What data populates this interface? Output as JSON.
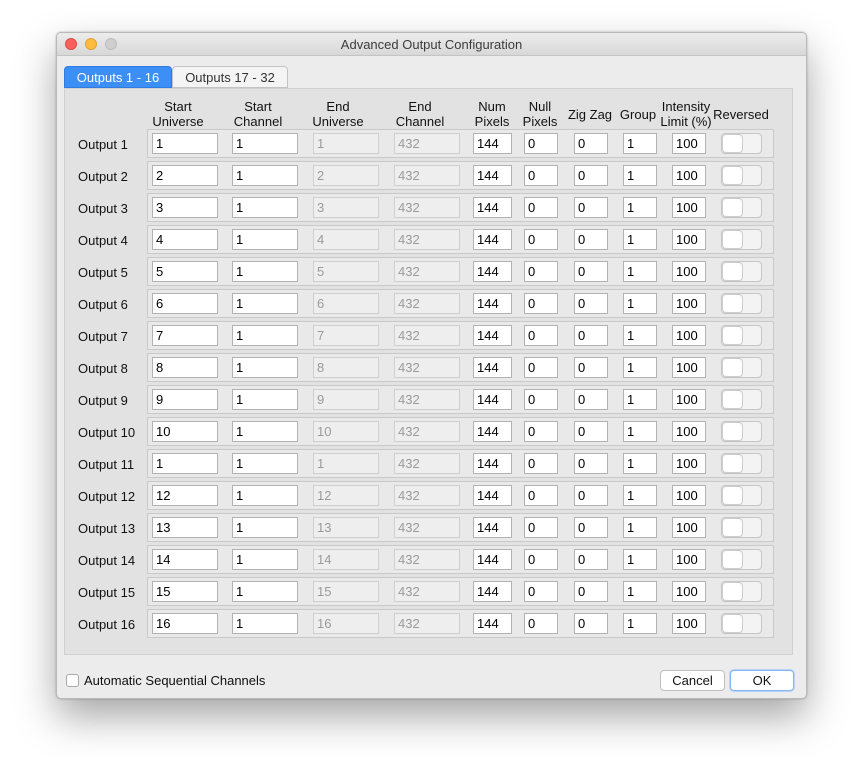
{
  "window": {
    "title": "Advanced Output Configuration"
  },
  "tabs": [
    {
      "label": "Outputs 1 - 16",
      "active": true
    },
    {
      "label": "Outputs 17 - 32",
      "active": false
    }
  ],
  "columns": {
    "start_universe": [
      "Start",
      "Universe"
    ],
    "start_channel": [
      "Start",
      "Channel"
    ],
    "end_universe": [
      "End",
      "Universe"
    ],
    "end_channel": [
      "End",
      "Channel"
    ],
    "num_pixels": [
      "Num",
      "Pixels"
    ],
    "null_pixels": [
      "Null",
      "Pixels"
    ],
    "zig_zag": [
      "Zig Zag"
    ],
    "group": [
      "Group"
    ],
    "intensity": [
      "Intensity",
      "Limit (%)"
    ],
    "reversed": [
      "Reversed"
    ]
  },
  "rows": [
    {
      "label": "Output 1",
      "start_universe": "1",
      "start_channel": "1",
      "end_universe": "1",
      "end_channel": "432",
      "num_pixels": "144",
      "null_pixels": "0",
      "zig_zag": "0",
      "group": "1",
      "intensity": "100",
      "reversed": false
    },
    {
      "label": "Output 2",
      "start_universe": "2",
      "start_channel": "1",
      "end_universe": "2",
      "end_channel": "432",
      "num_pixels": "144",
      "null_pixels": "0",
      "zig_zag": "0",
      "group": "1",
      "intensity": "100",
      "reversed": false
    },
    {
      "label": "Output 3",
      "start_universe": "3",
      "start_channel": "1",
      "end_universe": "3",
      "end_channel": "432",
      "num_pixels": "144",
      "null_pixels": "0",
      "zig_zag": "0",
      "group": "1",
      "intensity": "100",
      "reversed": false
    },
    {
      "label": "Output 4",
      "start_universe": "4",
      "start_channel": "1",
      "end_universe": "4",
      "end_channel": "432",
      "num_pixels": "144",
      "null_pixels": "0",
      "zig_zag": "0",
      "group": "1",
      "intensity": "100",
      "reversed": false
    },
    {
      "label": "Output 5",
      "start_universe": "5",
      "start_channel": "1",
      "end_universe": "5",
      "end_channel": "432",
      "num_pixels": "144",
      "null_pixels": "0",
      "zig_zag": "0",
      "group": "1",
      "intensity": "100",
      "reversed": false
    },
    {
      "label": "Output 6",
      "start_universe": "6",
      "start_channel": "1",
      "end_universe": "6",
      "end_channel": "432",
      "num_pixels": "144",
      "null_pixels": "0",
      "zig_zag": "0",
      "group": "1",
      "intensity": "100",
      "reversed": false
    },
    {
      "label": "Output 7",
      "start_universe": "7",
      "start_channel": "1",
      "end_universe": "7",
      "end_channel": "432",
      "num_pixels": "144",
      "null_pixels": "0",
      "zig_zag": "0",
      "group": "1",
      "intensity": "100",
      "reversed": false
    },
    {
      "label": "Output 8",
      "start_universe": "8",
      "start_channel": "1",
      "end_universe": "8",
      "end_channel": "432",
      "num_pixels": "144",
      "null_pixels": "0",
      "zig_zag": "0",
      "group": "1",
      "intensity": "100",
      "reversed": false
    },
    {
      "label": "Output 9",
      "start_universe": "9",
      "start_channel": "1",
      "end_universe": "9",
      "end_channel": "432",
      "num_pixels": "144",
      "null_pixels": "0",
      "zig_zag": "0",
      "group": "1",
      "intensity": "100",
      "reversed": false
    },
    {
      "label": "Output 10",
      "start_universe": "10",
      "start_channel": "1",
      "end_universe": "10",
      "end_channel": "432",
      "num_pixels": "144",
      "null_pixels": "0",
      "zig_zag": "0",
      "group": "1",
      "intensity": "100",
      "reversed": false
    },
    {
      "label": "Output 11",
      "start_universe": "1",
      "start_channel": "1",
      "end_universe": "1",
      "end_channel": "432",
      "num_pixels": "144",
      "null_pixels": "0",
      "zig_zag": "0",
      "group": "1",
      "intensity": "100",
      "reversed": false
    },
    {
      "label": "Output 12",
      "start_universe": "12",
      "start_channel": "1",
      "end_universe": "12",
      "end_channel": "432",
      "num_pixels": "144",
      "null_pixels": "0",
      "zig_zag": "0",
      "group": "1",
      "intensity": "100",
      "reversed": false
    },
    {
      "label": "Output 13",
      "start_universe": "13",
      "start_channel": "1",
      "end_universe": "13",
      "end_channel": "432",
      "num_pixels": "144",
      "null_pixels": "0",
      "zig_zag": "0",
      "group": "1",
      "intensity": "100",
      "reversed": false
    },
    {
      "label": "Output 14",
      "start_universe": "14",
      "start_channel": "1",
      "end_universe": "14",
      "end_channel": "432",
      "num_pixels": "144",
      "null_pixels": "0",
      "zig_zag": "0",
      "group": "1",
      "intensity": "100",
      "reversed": false
    },
    {
      "label": "Output 15",
      "start_universe": "15",
      "start_channel": "1",
      "end_universe": "15",
      "end_channel": "432",
      "num_pixels": "144",
      "null_pixels": "0",
      "zig_zag": "0",
      "group": "1",
      "intensity": "100",
      "reversed": false
    },
    {
      "label": "Output 16",
      "start_universe": "16",
      "start_channel": "1",
      "end_universe": "16",
      "end_channel": "432",
      "num_pixels": "144",
      "null_pixels": "0",
      "zig_zag": "0",
      "group": "1",
      "intensity": "100",
      "reversed": false
    }
  ],
  "footer": {
    "auto_sequential_label": "Automatic Sequential Channels",
    "auto_sequential_checked": false,
    "cancel_label": "Cancel",
    "ok_label": "OK"
  },
  "colors": {
    "accent": "#3b8ff5",
    "close": "#fc605c",
    "minimize": "#fdbc40"
  }
}
